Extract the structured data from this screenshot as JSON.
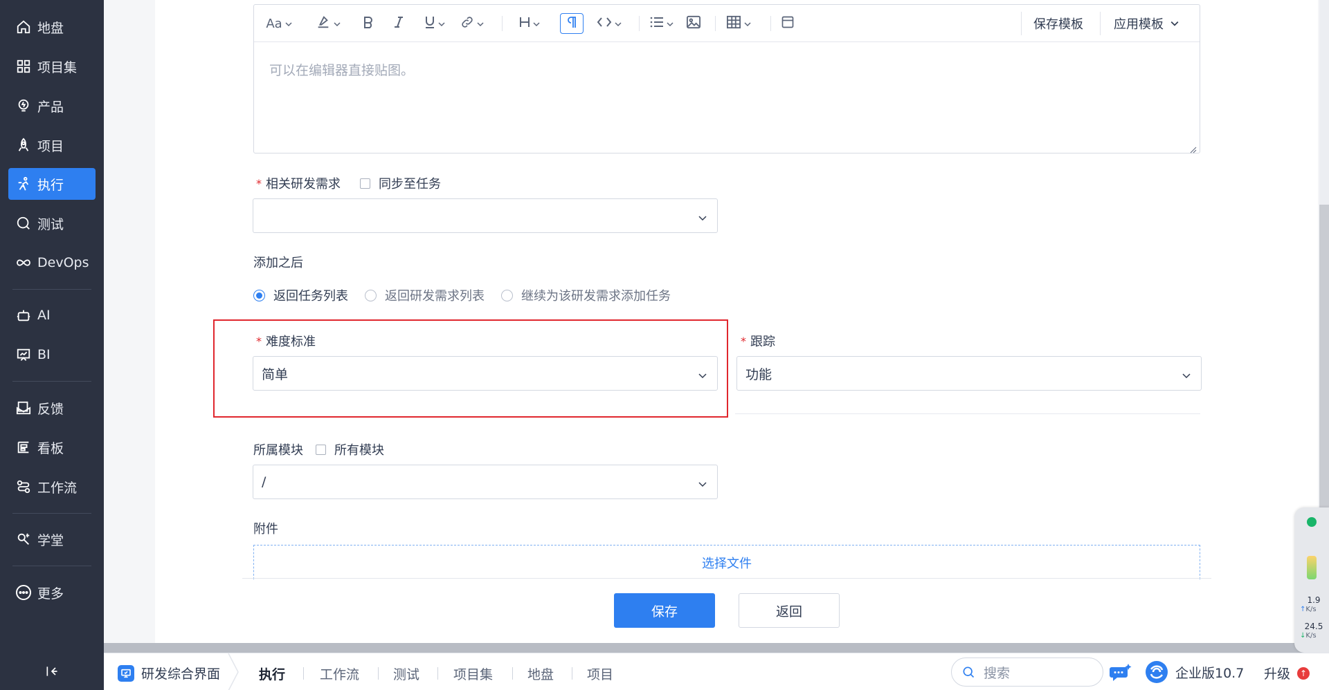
{
  "sidebar": {
    "items": [
      {
        "label": "地盘",
        "icon": "home-icon"
      },
      {
        "label": "项目集",
        "icon": "grid-icon"
      },
      {
        "label": "产品",
        "icon": "bulb-icon"
      },
      {
        "label": "项目",
        "icon": "rocket-icon"
      },
      {
        "label": "执行",
        "icon": "run-icon",
        "active": true
      },
      {
        "label": "测试",
        "icon": "search-test-icon"
      },
      {
        "label": "DevOps",
        "icon": "infinity-icon"
      },
      {
        "label": "AI",
        "icon": "robot-icon"
      },
      {
        "label": "BI",
        "icon": "chart-board-icon"
      },
      {
        "label": "反馈",
        "icon": "feedback-icon"
      },
      {
        "label": "看板",
        "icon": "kanban-icon"
      },
      {
        "label": "工作流",
        "icon": "workflow-icon"
      },
      {
        "label": "学堂",
        "icon": "school-icon"
      },
      {
        "label": "更多",
        "icon": "more-icon"
      }
    ],
    "collapse_icon": "collapse-left-icon"
  },
  "editor": {
    "toolbar": {
      "font_size_label": "Aa",
      "save_template": "保存模板",
      "apply_template": "应用模板"
    },
    "placeholder": "可以在编辑器直接贴图。"
  },
  "form": {
    "related_story": {
      "label": "相关研发需求",
      "sync_label": "同步至任务",
      "value": ""
    },
    "after_add": {
      "label": "添加之后",
      "options": [
        "返回任务列表",
        "返回研发需求列表",
        "继续为该研发需求添加任务"
      ],
      "selected_index": 0
    },
    "difficulty": {
      "label": "难度标准",
      "value": "简单"
    },
    "tracking": {
      "label": "跟踪",
      "value": "功能"
    },
    "module": {
      "label": "所属模块",
      "all_label": "所有模块",
      "value": "/"
    },
    "attachment": {
      "label": "附件",
      "choose_file": "选择文件"
    }
  },
  "actions": {
    "save": "保存",
    "back": "返回"
  },
  "float_panel": {
    "up_speed": "1.9",
    "up_unit": "K/s",
    "down_speed": "24.5",
    "down_unit": "K/s"
  },
  "taskbar": {
    "app_name": "研发综合界面",
    "tabs": [
      "执行",
      "工作流",
      "测试",
      "项目集",
      "地盘",
      "项目"
    ],
    "active_tab": 0,
    "search_placeholder": "搜索",
    "edition": "企业版10.7",
    "upgrade": "升级"
  },
  "colors": {
    "primary": "#2e7ff0",
    "sidebar_bg": "#2c3241",
    "highlight": "#e0262d",
    "required": "#e0292e"
  }
}
